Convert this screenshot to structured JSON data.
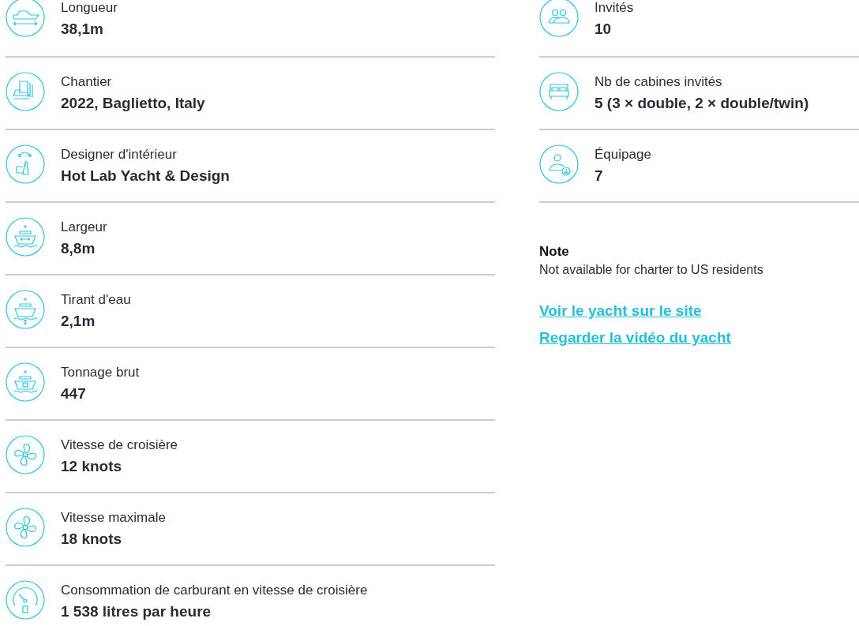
{
  "specs_left": [
    {
      "label": "Longueur",
      "value": "38,1m"
    },
    {
      "label": "Chantier",
      "value": "2022, Baglietto, Italy"
    },
    {
      "label": "Designer d'intérieur",
      "value": "Hot Lab Yacht & Design"
    },
    {
      "label": "Largeur",
      "value": "8,8m"
    },
    {
      "label": "Tirant d'eau",
      "value": "2,1m"
    },
    {
      "label": "Tonnage brut",
      "value": "447"
    },
    {
      "label": "Vitesse de croisière",
      "value": "12 knots"
    },
    {
      "label": "Vitesse maximale",
      "value": "18 knots"
    },
    {
      "label": "Consommation de carburant en vitesse de croisière",
      "value": "1 538 litres par heure"
    }
  ],
  "specs_right": [
    {
      "label": "Invités",
      "value": "10"
    },
    {
      "label": "Nb de cabines invités",
      "value": "5 (3 × double, 2 × double/twin)"
    },
    {
      "label": "Équipage",
      "value": "7"
    }
  ],
  "note": {
    "title": "Note",
    "text": "Not available for charter to US residents"
  },
  "links": [
    "Voir le yacht sur le site",
    "Regarder la vidéo du yacht"
  ]
}
